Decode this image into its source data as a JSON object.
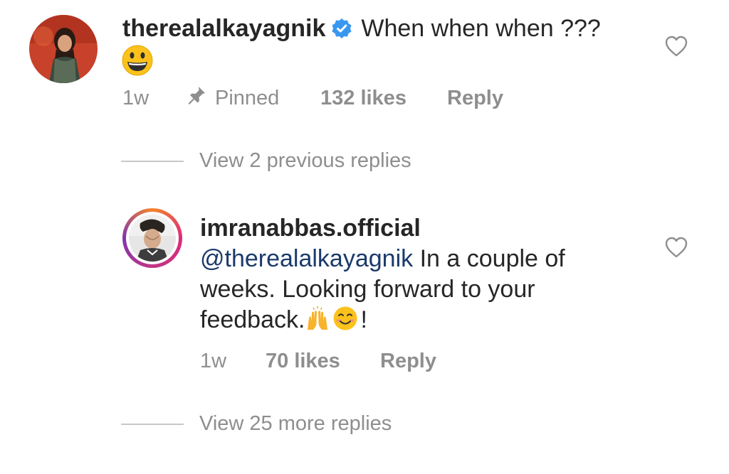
{
  "comment": {
    "username": "therealalkayagnik",
    "verified": true,
    "text": "When when when ???",
    "emoji": "grinning-face",
    "time": "1w",
    "pinned_label": "Pinned",
    "likes": "132 likes",
    "reply_label": "Reply"
  },
  "previous_replies": {
    "label": "View 2 previous replies"
  },
  "reply": {
    "username": "imranabbas.official",
    "mention": "@therealalkayagnik",
    "text_line1": " In a couple of",
    "text_line2": "weeks. Looking forward to your",
    "text_line3": "feedback.",
    "text_end": "!",
    "emojis": [
      "raising-hands",
      "smiling-face"
    ],
    "time": "1w",
    "likes": "70 likes",
    "reply_label": "Reply"
  },
  "more_replies": {
    "label": "View 25 more replies"
  },
  "colors": {
    "text": "#262626",
    "muted": "#8e8e8e",
    "mention": "#1b3a6b",
    "verified": "#3897f0"
  }
}
